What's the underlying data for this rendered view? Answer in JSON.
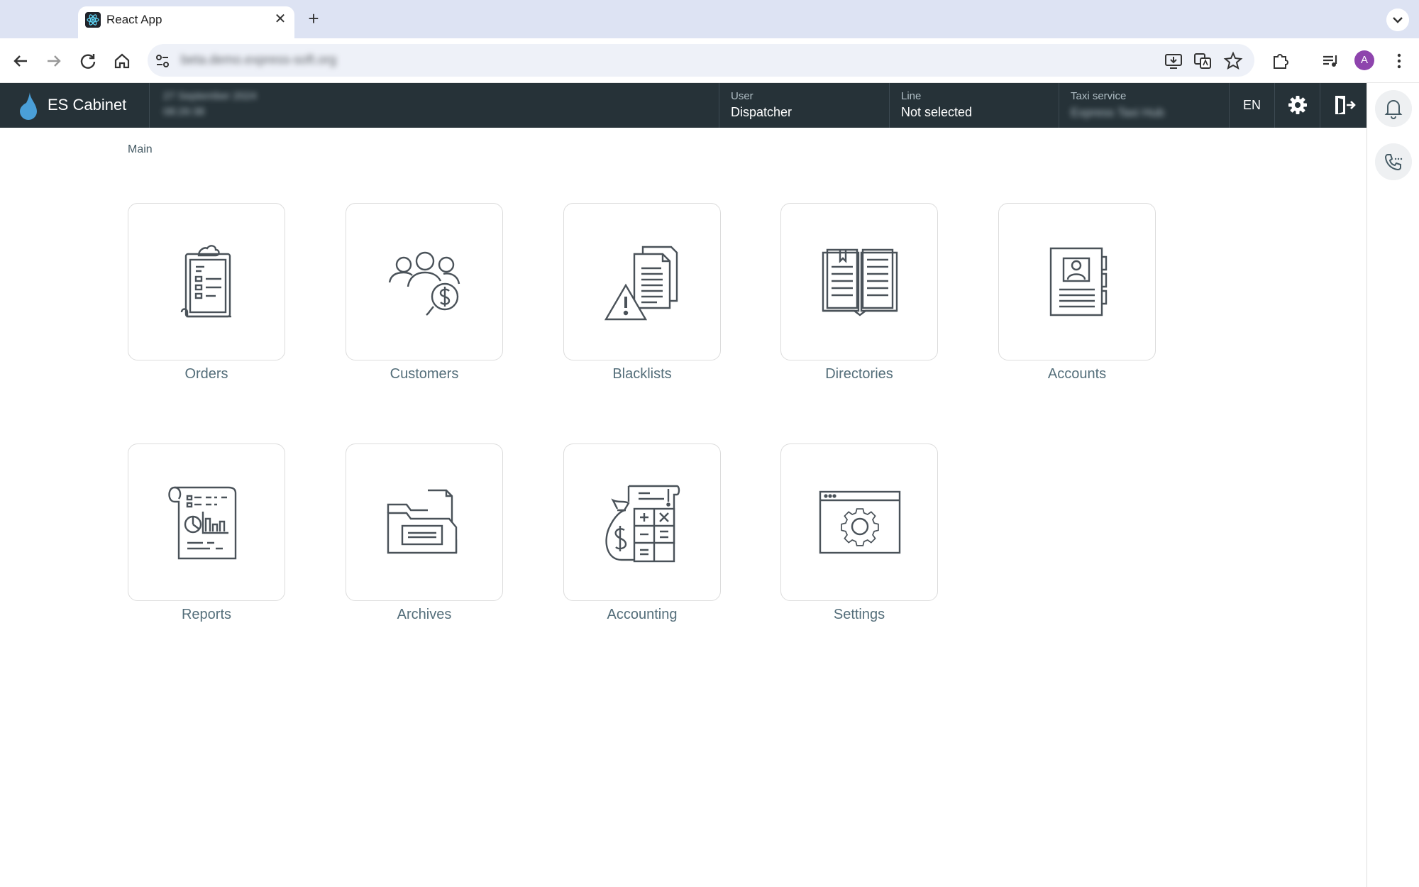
{
  "browser": {
    "tab_title": "React App",
    "tab_close": "✕",
    "new_tab": "+",
    "url": "beta.demo.express-soft.org"
  },
  "profile": {
    "initial": "A"
  },
  "app": {
    "brand": "ES Cabinet",
    "date_blurred": "27 September 2024",
    "time_blurred": "08:26:38",
    "user": {
      "label": "User",
      "value": "Dispatcher"
    },
    "line": {
      "label": "Line",
      "value": "Not selected"
    },
    "taxi": {
      "label": "Taxi service",
      "value_blurred": "Express Taxi Hub"
    },
    "language": "EN",
    "accent": "#4a9fd8",
    "header_bg": "#263238"
  },
  "breadcrumb": "Main",
  "tiles": [
    {
      "label": "Orders",
      "icon": "clipboard-icon"
    },
    {
      "label": "Customers",
      "icon": "customers-dollar-icon"
    },
    {
      "label": "Blacklists",
      "icon": "documents-warning-icon"
    },
    {
      "label": "Directories",
      "icon": "open-book-icon"
    },
    {
      "label": "Accounts",
      "icon": "account-card-icon"
    },
    {
      "label": "Reports",
      "icon": "report-scroll-icon"
    },
    {
      "label": "Archives",
      "icon": "archive-folder-icon"
    },
    {
      "label": "Accounting",
      "icon": "calculator-money-icon"
    },
    {
      "label": "Settings",
      "icon": "settings-window-icon"
    }
  ]
}
